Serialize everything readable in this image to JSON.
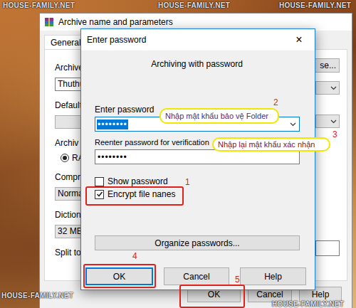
{
  "watermarks": {
    "top": [
      "HOUSE-FAMILY.NET",
      "HOUSE-FAMILY.NET",
      "HOUSE-FAMILY.NET"
    ],
    "bottom": [
      "HOUSE-FAMILY.NET",
      "HOUSE-FAMILY.NET"
    ]
  },
  "back_window": {
    "title": "Archive name and parameters",
    "tabs": [
      {
        "label": "General",
        "selected": true
      }
    ],
    "left_items": [
      {
        "kind": "label",
        "text": "Archive"
      },
      {
        "kind": "field",
        "text": "Thuthu"
      },
      {
        "kind": "label",
        "text": "Default"
      },
      {
        "kind": "combo",
        "text": ""
      },
      {
        "kind": "label",
        "text": "Archiv"
      },
      {
        "kind": "radio",
        "text": "RA",
        "selected": true
      },
      {
        "kind": "label",
        "text": "Compre"
      },
      {
        "kind": "combo",
        "text": "Norma"
      },
      {
        "kind": "label",
        "text": "Dictiona"
      },
      {
        "kind": "combo",
        "text": "32 MB"
      },
      {
        "kind": "label",
        "text": "Split to"
      }
    ],
    "browse_button": "se...",
    "buttons": [
      {
        "label": "OK"
      },
      {
        "label": "Cancel"
      },
      {
        "label": "Help"
      }
    ]
  },
  "dialog": {
    "title": "Enter password",
    "close": "×",
    "heading": "Archiving with password",
    "fields": [
      {
        "label": "Enter password",
        "value": "••••••••",
        "selected": true,
        "dropdown": true
      },
      {
        "label": "Reenter password for verification",
        "value": "••••••••",
        "selected": false,
        "dropdown": false
      }
    ],
    "checkboxes": [
      {
        "label": "Show password",
        "checked": false
      },
      {
        "label": "Encrypt file nanes",
        "checked": true
      }
    ],
    "organize_button": "Organize passwords...",
    "buttons": [
      {
        "label": "OK",
        "default": true
      },
      {
        "label": "Cancel",
        "default": false
      },
      {
        "label": "Help",
        "default": false
      }
    ]
  },
  "annotations": {
    "callouts": [
      {
        "text": "Nhập mật khẩu bảo vệ Folder",
        "number": "2",
        "color": "#4b2a8a"
      },
      {
        "text": "Nhập lại mật khẩu xác nhận",
        "number": "3",
        "color": "#7a1540"
      }
    ],
    "highlights": [
      {
        "number": "1"
      },
      {
        "number": "4"
      },
      {
        "number": "5"
      }
    ]
  }
}
